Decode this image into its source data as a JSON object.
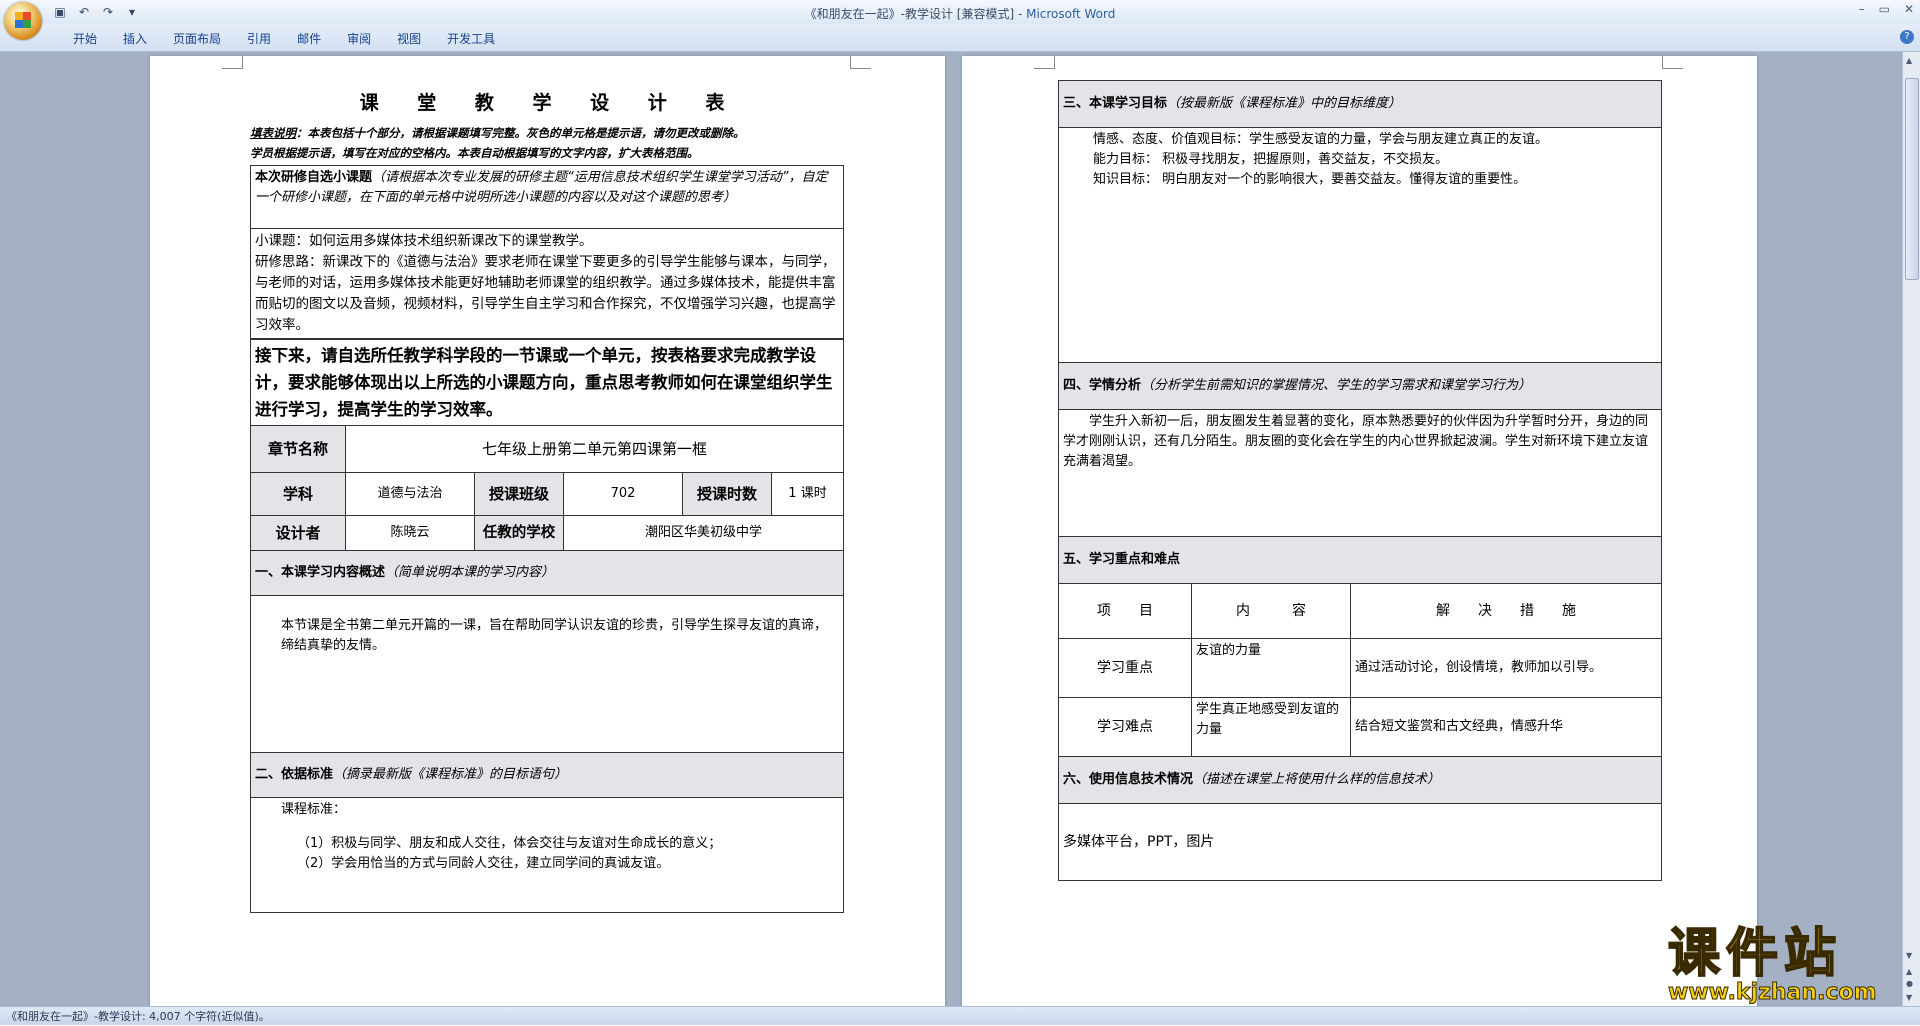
{
  "window": {
    "title_doc": "《和朋友在一起》-教学设计 [兼容模式] - ",
    "title_app": "Microsoft Word"
  },
  "ribbon": {
    "tabs": [
      "开始",
      "插入",
      "页面布局",
      "引用",
      "邮件",
      "审阅",
      "视图",
      "开发工具"
    ]
  },
  "status_bar": {
    "text": "《和朋友在一起》-教学设计: 4,007 个字符(近似值)。"
  },
  "page1": {
    "heading": "课 堂 教 学 设 计 表",
    "fill_note_label": "填表说明",
    "fill_note_line1": "：本表包括十个部分，请根据课题填写完整。灰色的单元格是提示语，请勿更改或删除。",
    "fill_note_line2": "学员根据提示语，填写在对应的空格内。本表自动根据填写的文字内容，扩大表格范围。",
    "topic_title": "本次研修自选小课题",
    "topic_hint": "（请根据本次专业发展的研修主题“运用信息技术组织学生课堂学习活动”，自定一个研修小课题，在下面的单元格中说明所选小课题的内容以及对这个课题的思考）",
    "topic_line1": "小课题：如何运用多媒体技术组织新课改下的课堂教学。",
    "topic_line2": "研修思路：新课改下的《道德与法治》要求老师在课堂下要更多的引导学生能够与课本，与同学，与老师的对话，运用多媒体技术能更好地辅助老师课堂的组织教学。通过多媒体技术，能提供丰富而贴切的图文以及音频，视频材料，引导学生自主学习和合作探究，不仅增强学习兴趣，也提高学习效率。",
    "instruction": "接下来，请自选所任教学科学段的一节课或一个单元，按表格要求完成教学设计，要求能够体现出以上所选的小课题方向，重点思考教师如何在课堂组织学生进行学习，提高学生的学习效率。",
    "chapter_label": "章节名称",
    "chapter_value": "七年级上册第二单元第四课第一框",
    "subject_label": "学科",
    "subject_value": "道德与法治",
    "class_label": "授课班级",
    "class_value": "702",
    "hours_label": "授课时数",
    "hours_value": "1 课时",
    "designer_label": "设计者",
    "designer_value": "陈晓云",
    "school_label": "任教的学校",
    "school_value": "潮阳区华美初级中学",
    "sec1_title": "一、本课学习内容概述",
    "sec1_hint": "（简单说明本课的学习内容）",
    "sec1_body": "本节课是全书第二单元开篇的一课，旨在帮助同学认识友谊的珍贵，引导学生探寻友谊的真谛，缔结真挚的友情。",
    "sec2_title": "二、依据标准",
    "sec2_hint": "（摘录最新版《课程标准》的目标语句）",
    "sec2_label": "课程标准：",
    "sec2_item1": "（1）积极与同学、朋友和成人交往，体会交往与友谊对生命成长的意义；",
    "sec2_item2": "（2）学会用恰当的方式与同龄人交往，建立同学间的真诚友谊。"
  },
  "page2": {
    "sec3_title": "三、本课学习目标",
    "sec3_hint": "（按最新版《课程标准》中的目标维度）",
    "sec3_goal1": "情感、态度、价值观目标：学生感受友谊的力量，学会与朋友建立真正的友谊。",
    "sec3_goal2": "能力目标：  积极寻找朋友，把握原则，善交益友，不交损友。",
    "sec3_goal3": "知识目标：  明白朋友对一个的影响很大，要善交益友。懂得友谊的重要性。",
    "sec4_title": "四、学情分析",
    "sec4_hint": "（分析学生前需知识的掌握情况、学生的学习需求和课堂学习行为）",
    "sec4_body": "学生升入新初一后，朋友圈发生着显著的变化，原本熟悉要好的伙伴因为升学暂时分开，身边的同学才刚刚认识，还有几分陌生。朋友圈的变化会在学生的内心世界掀起波澜。学生对新环境下建立友谊充满着渴望。",
    "sec5_title": "五、学习重点和难点",
    "col_item": "项　　目",
    "col_content": "内　　　容",
    "col_measure": "解　　决　　措　　施",
    "key_label": "学习重点",
    "key_content": "友谊的力量",
    "key_measure": "通过活动讨论，创设情境，教师加以引导。",
    "diff_label": "学习难点",
    "diff_content": "学生真正地感受到友谊的力量",
    "diff_measure": "结合短文鉴赏和古文经典，情感升华",
    "sec6_title": "六、使用信息技术情况",
    "sec6_hint": "（描述在课堂上将使用什么样的信息技术）",
    "sec6_body": "多媒体平台，PPT，图片"
  },
  "watermark": {
    "brand": "课件站",
    "url": "www.kjzhan.com"
  },
  "colors": {
    "workspace": "#a4b1c4",
    "shade": "#e2e4e8",
    "watermark": "#f7d21a"
  }
}
